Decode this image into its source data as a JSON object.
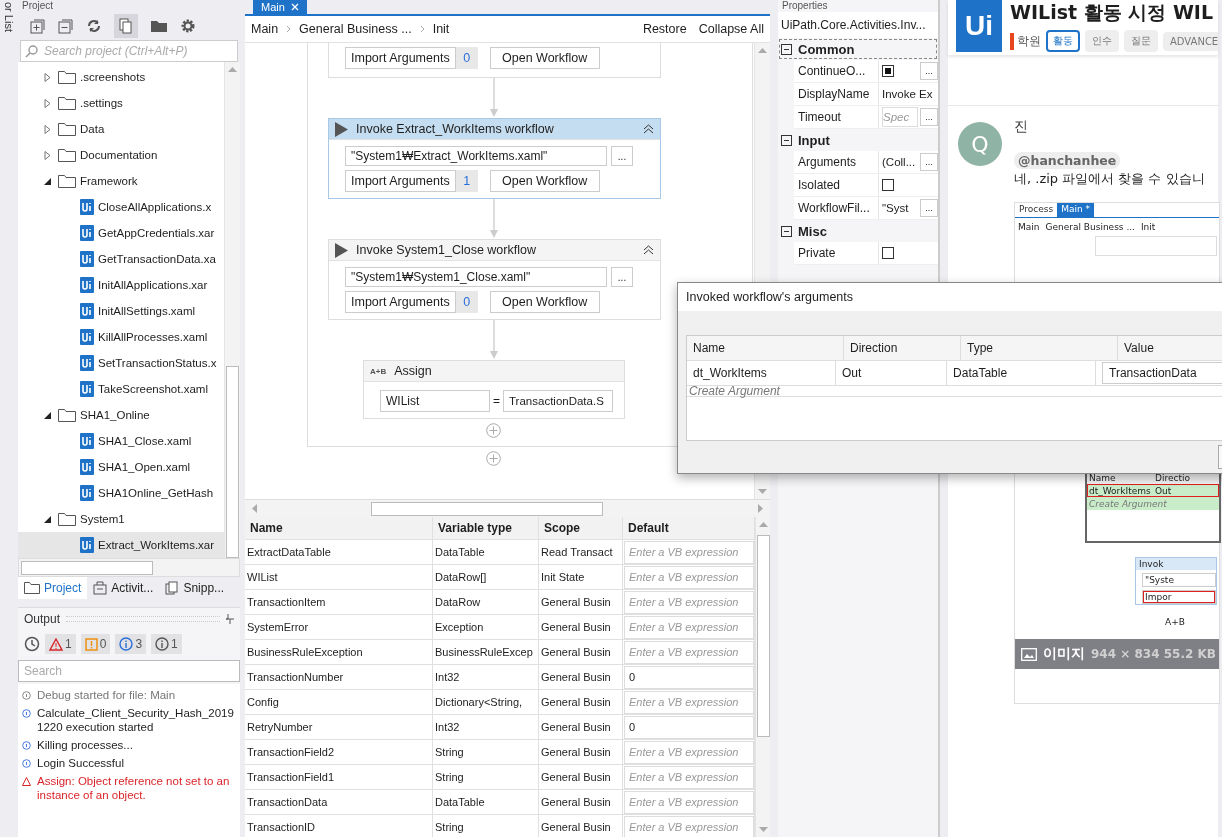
{
  "side_strip": {
    "label": "or List"
  },
  "project": {
    "title": "Project",
    "search_placeholder": "Search project (Ctrl+Alt+P)",
    "tree": [
      {
        "kind": "folder",
        "label": ".screenshots",
        "expanded": false,
        "selected": false
      },
      {
        "kind": "folder",
        "label": ".settings",
        "expanded": false,
        "selected": false
      },
      {
        "kind": "folder",
        "label": "Data",
        "expanded": false,
        "selected": false
      },
      {
        "kind": "folder",
        "label": "Documentation",
        "expanded": false,
        "selected": false
      },
      {
        "kind": "folder",
        "label": "Framework",
        "expanded": true,
        "selected": false,
        "children": [
          {
            "kind": "file",
            "label": "CloseAllApplications.x",
            "selected": false
          },
          {
            "kind": "file",
            "label": "GetAppCredentials.xar",
            "selected": false
          },
          {
            "kind": "file",
            "label": "GetTransactionData.xa",
            "selected": false
          },
          {
            "kind": "file",
            "label": "InitAllApplications.xar",
            "selected": false
          },
          {
            "kind": "file",
            "label": "InitAllSettings.xaml",
            "selected": false
          },
          {
            "kind": "file",
            "label": "KillAllProcesses.xaml",
            "selected": false
          },
          {
            "kind": "file",
            "label": "SetTransactionStatus.x",
            "selected": false
          },
          {
            "kind": "file",
            "label": "TakeScreenshot.xaml",
            "selected": false
          }
        ]
      },
      {
        "kind": "folder",
        "label": "SHA1_Online",
        "expanded": true,
        "selected": false,
        "children": [
          {
            "kind": "file",
            "label": "SHA1_Close.xaml",
            "selected": false
          },
          {
            "kind": "file",
            "label": "SHA1_Open.xaml",
            "selected": false
          },
          {
            "kind": "file",
            "label": "SHA1Online_GetHash",
            "selected": false
          }
        ]
      },
      {
        "kind": "folder",
        "label": "System1",
        "expanded": true,
        "selected": false,
        "children": [
          {
            "kind": "file",
            "label": "Extract_WorkItems.xar",
            "selected": true
          }
        ]
      }
    ],
    "tabs": [
      {
        "label": "Project",
        "kind": "project",
        "selected": true
      },
      {
        "label": "Activit...",
        "kind": "activities",
        "selected": false
      },
      {
        "label": "Snipp...",
        "kind": "snippets",
        "selected": false
      }
    ]
  },
  "output": {
    "title": "Output",
    "filters": [
      {
        "kind": "history"
      },
      {
        "kind": "error",
        "count": "1"
      },
      {
        "kind": "warning",
        "count": "0"
      },
      {
        "kind": "info",
        "count": "3"
      },
      {
        "kind": "trace",
        "count": "1"
      }
    ],
    "search_placeholder": "Search",
    "messages": [
      {
        "kind": "trace",
        "text": "Debug started for file: Main"
      },
      {
        "kind": "info",
        "text": "Calculate_Client_Security_Hash_20191220 execution started"
      },
      {
        "kind": "info",
        "text": "Killing processes..."
      },
      {
        "kind": "info",
        "text": "Login Successful"
      },
      {
        "kind": "error",
        "text": "Assign: Object reference not set to an instance of an object."
      }
    ]
  },
  "designer": {
    "tab": "Main",
    "breadcrumb": [
      "Main",
      "General Business ...",
      "Init"
    ],
    "actions": [
      "Restore",
      "Collapse All"
    ],
    "activities": [
      {
        "kind": "invoke_partial",
        "import_label": "Import Arguments",
        "count": "0",
        "open_label": "Open Workflow"
      },
      {
        "kind": "invoke",
        "title": "Invoke Extract_WorkItems workflow",
        "selected": true,
        "path": "\"System1₩Extract_WorkItems.xaml\"",
        "browse": "...",
        "import_label": "Import Arguments",
        "count": "1",
        "open_label": "Open Workflow"
      },
      {
        "kind": "invoke",
        "title": "Invoke System1_Close workflow",
        "selected": false,
        "path": "\"System1₩System1_Close.xaml\"",
        "browse": "...",
        "import_label": "Import Arguments",
        "count": "0",
        "open_label": "Open Workflow"
      },
      {
        "kind": "assign",
        "badge": "A+B",
        "title": "Assign",
        "left": "WIList",
        "eq": "=",
        "right": "TransactionData.S"
      }
    ]
  },
  "variables": {
    "columns": [
      "Name",
      "Variable type",
      "Scope",
      "Default"
    ],
    "rows": [
      {
        "name": "ExtractDataTable",
        "type": "DataTable",
        "scope": "Read Transact",
        "placeholder": "Enter a VB expression"
      },
      {
        "name": "WIList",
        "type": "DataRow[]",
        "scope": "Init State",
        "placeholder": "Enter a VB expression"
      },
      {
        "name": "TransactionItem",
        "type": "DataRow",
        "scope": "General Busin",
        "placeholder": "Enter a VB expression"
      },
      {
        "name": "SystemError",
        "type": "Exception",
        "scope": "General Busin",
        "placeholder": "Enter a VB expression"
      },
      {
        "name": "BusinessRuleException",
        "type": "BusinessRuleExcep",
        "scope": "General Busin",
        "placeholder": "Enter a VB expression"
      },
      {
        "name": "TransactionNumber",
        "type": "Int32",
        "scope": "General Busin",
        "default": "0"
      },
      {
        "name": "Config",
        "type": "Dictionary<String,",
        "scope": "General Busin",
        "placeholder": "Enter a VB expression"
      },
      {
        "name": "RetryNumber",
        "type": "Int32",
        "scope": "General Busin",
        "default": "0"
      },
      {
        "name": "TransactionField2",
        "type": "String",
        "scope": "General Busin",
        "placeholder": "Enter a VB expression"
      },
      {
        "name": "TransactionField1",
        "type": "String",
        "scope": "General Busin",
        "placeholder": "Enter a VB expression"
      },
      {
        "name": "TransactionData",
        "type": "DataTable",
        "scope": "General Busin",
        "placeholder": "Enter a VB expression"
      },
      {
        "name": "TransactionID",
        "type": "String",
        "scope": "General Busin",
        "placeholder": "Enter a VB expression"
      }
    ]
  },
  "properties": {
    "title": "Properties",
    "type": "UiPath.Core.Activities.Inv...",
    "groups": [
      {
        "label": "Common",
        "rows": [
          {
            "kind": "checkbox",
            "label": "ContinueO...",
            "checked": true,
            "browse": "..."
          },
          {
            "kind": "text",
            "label": "DisplayName",
            "value": "Invoke Ex"
          },
          {
            "kind": "text",
            "label": "Timeout",
            "placeholder": "Spec",
            "browse": "..."
          }
        ]
      },
      {
        "label": "Input",
        "rows": [
          {
            "kind": "text",
            "label": "Arguments",
            "value": "(Coll...",
            "browse": "..."
          },
          {
            "kind": "checkbox",
            "label": "Isolated",
            "checked": false
          },
          {
            "kind": "text",
            "label": "WorkflowFil...",
            "value": "\"Syst",
            "browse": "..."
          }
        ]
      },
      {
        "label": "Misc",
        "rows": [
          {
            "kind": "checkbox",
            "label": "Private",
            "checked": false
          }
        ]
      }
    ]
  },
  "dialog": {
    "title": "Invoked workflow's arguments",
    "columns": [
      "Name",
      "Direction",
      "Type",
      "Value"
    ],
    "rows": [
      {
        "name": "dt_WorkItems",
        "direction": "Out",
        "type": "DataTable",
        "value": "TransactionData"
      }
    ],
    "create_placeholder": "Create Argument"
  },
  "web": {
    "logo": "Ui",
    "title": "WIList 활동 시정 WIL",
    "category": "학원",
    "tags": [
      {
        "label": "활동",
        "selected": true
      },
      {
        "label": "인수",
        "selected": false
      },
      {
        "label": "질문",
        "selected": false
      },
      {
        "label": "ADVANCE",
        "selected": false
      }
    ],
    "comment": {
      "avatar": "Q",
      "author": "진",
      "mention": "@hanchanhee",
      "text": "네, .zip 파일에서 찾을 수 있습니",
      "image": {
        "tabs": [
          {
            "label": "Process",
            "selected": false
          },
          {
            "label": "Main *",
            "selected": true
          }
        ],
        "breadcrumb": [
          "Main",
          "General Business ...",
          "Init"
        ],
        "columns": [
          "Name",
          "Directio"
        ],
        "row": [
          "dt_WorkItems",
          "Out"
        ],
        "create_placeholder": "Create Argument",
        "invoke_title": "Invok",
        "invoke_path": "\"Syste",
        "invoke_import": "Impor",
        "assign_badge": "A+B",
        "caption": "이미지",
        "info": "944 × 834 55.2 KB"
      }
    }
  }
}
